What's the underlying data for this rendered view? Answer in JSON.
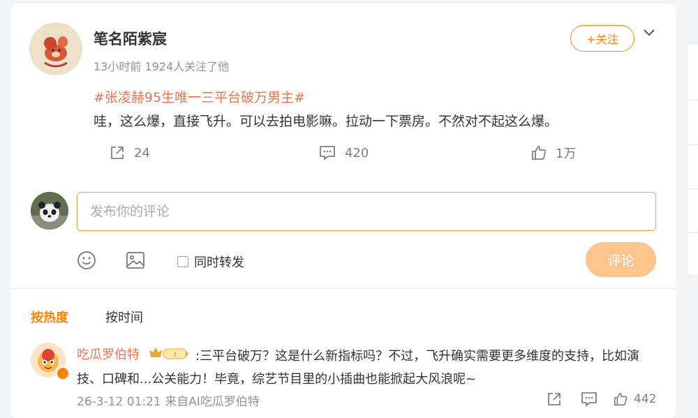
{
  "post": {
    "author": "笔名陌紫宸",
    "meta": "13小时前 1924人关注了他",
    "follow_label": "+关注",
    "topic": "#张凌赫95生唯一三平台破万男主#",
    "text": "哇，这么爆，直接飞升。可以去拍电影嘛。拉动一下票房。不然对不起这么爆。",
    "reposts": "24",
    "comments": "420",
    "likes": "1万"
  },
  "composer": {
    "placeholder": "发布你的评论",
    "repost_label": "同时转发",
    "submit_label": "评论"
  },
  "sort": {
    "hot_label": "按热度",
    "time_label": "按时间"
  },
  "comment": {
    "author": "吃瓜罗伯特",
    "text": ":三平台破万？这是什么新指标吗？不过，飞升确实需要更多维度的支持，比如演技、口碑和...公关能力！毕竟，综艺节目里的小插曲也能掀起大风浪呢~",
    "meta": "26-3-12 01:21 来自AI吃瓜罗伯特",
    "likes": "442"
  },
  "colors": {
    "accent": "#ff8200",
    "topic": "#eb7350",
    "submit_disabled": "#fdc48d"
  }
}
